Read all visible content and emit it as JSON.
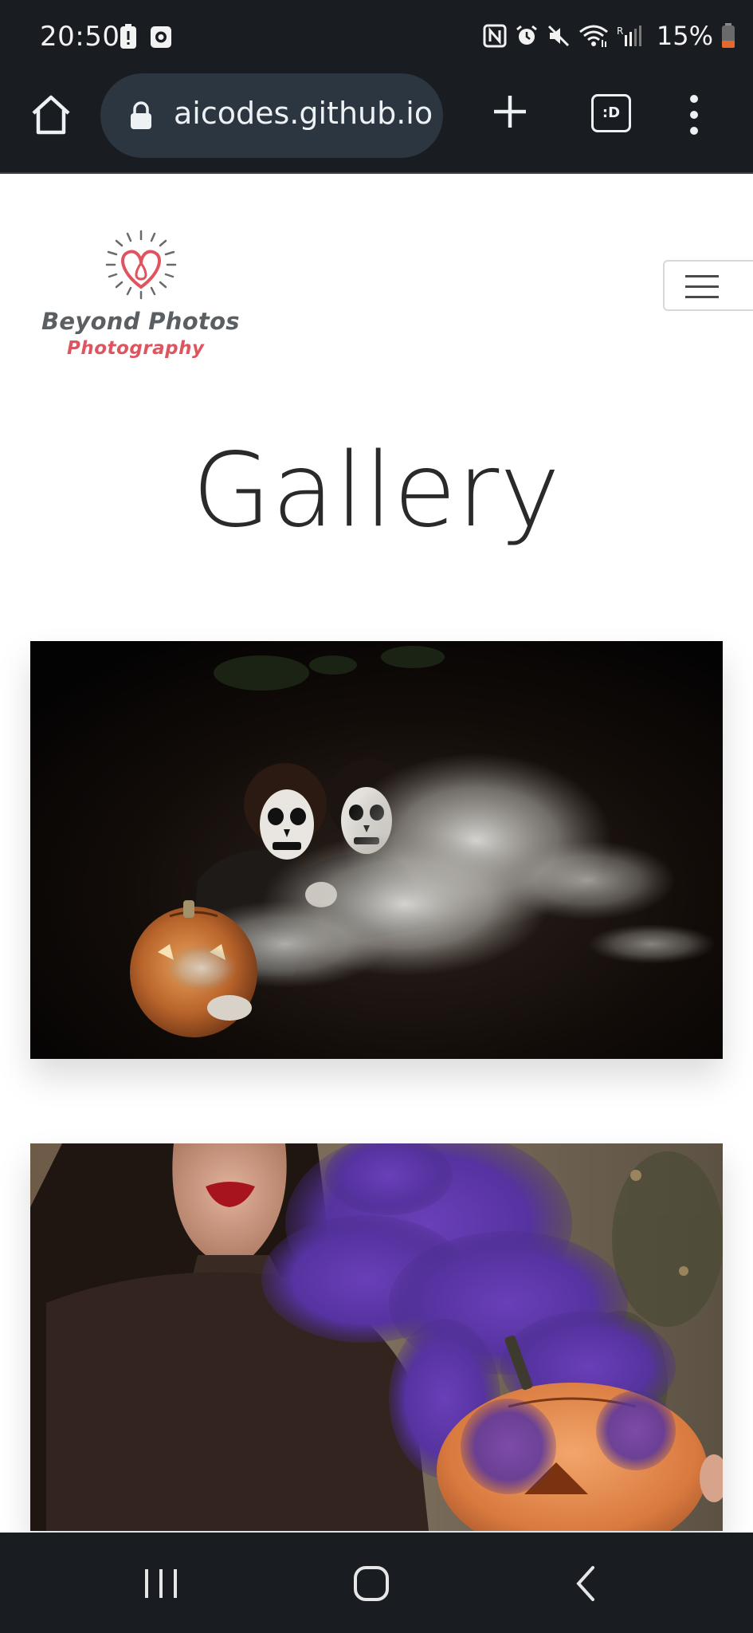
{
  "status_bar": {
    "time": "20:50",
    "battery_percent": "15%",
    "left_icons": [
      "battery-alert-icon",
      "screen-record-icon"
    ],
    "right_icons": [
      "nfc-icon",
      "alarm-icon",
      "mute-icon",
      "wifi-icon",
      "signal-icon",
      "battery-icon"
    ]
  },
  "browser": {
    "url": "aicodes.github.io",
    "tabs_badge": ":D",
    "icons": [
      "home-icon",
      "lock-icon",
      "plus-icon",
      "tabs-icon",
      "more-vert-icon"
    ]
  },
  "site": {
    "logo_title": "Beyond Photos",
    "logo_subtitle": "Photography",
    "page_title": "Gallery",
    "accent_color": "#e0545f",
    "menu_icon": "hamburger-menu-icon"
  },
  "gallery": {
    "images": [
      "skeleton-makeup-smoke-pumpkin-photo",
      "purple-smoke-pumpkin-woman-photo"
    ]
  },
  "nav_bar": {
    "icons": [
      "recents-icon",
      "home-circle-icon",
      "back-icon"
    ]
  }
}
